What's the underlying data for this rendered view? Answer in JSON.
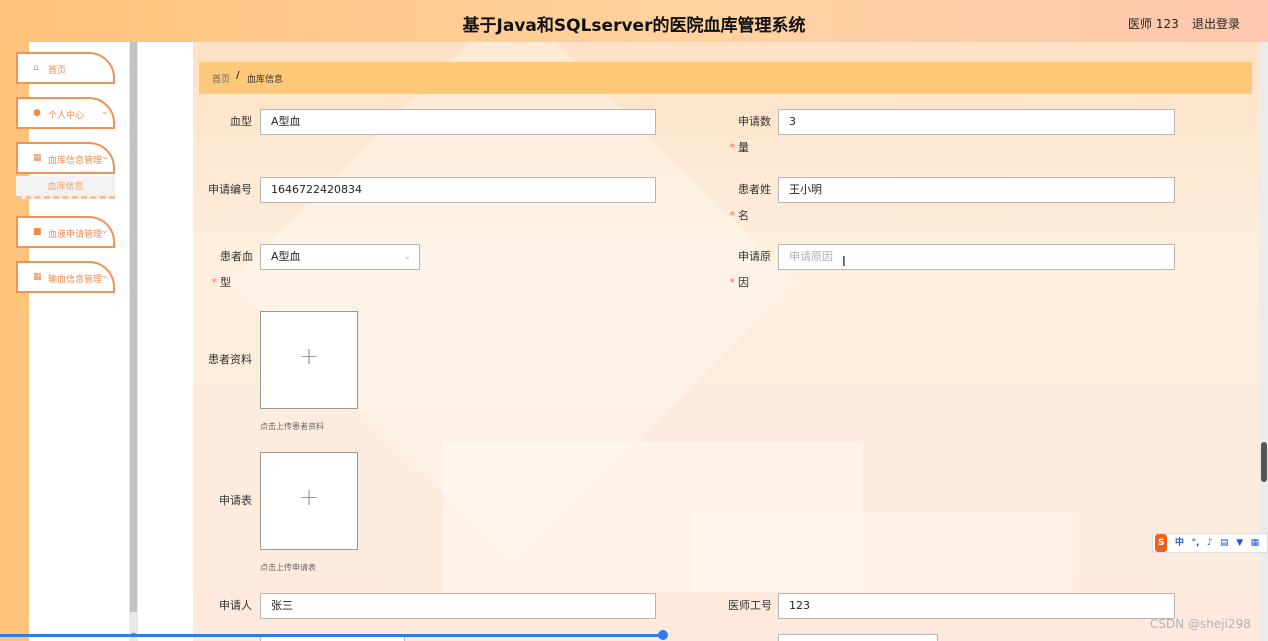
{
  "header": {
    "title": "基于Java和SQLserver的医院血库管理系统",
    "user": "医师 123",
    "logout": "退出登录"
  },
  "sidebar": {
    "items": [
      {
        "label": "首页",
        "icon": "home-icon"
      },
      {
        "label": "个人中心",
        "icon": "user-icon"
      },
      {
        "label": "血库信息管理",
        "icon": "grid-icon"
      },
      {
        "label": "血液申请管理",
        "icon": "blood-icon"
      },
      {
        "label": "输血信息管理",
        "icon": "grid-icon"
      }
    ],
    "submenu_label": "血库信息"
  },
  "breadcrumb": {
    "home": "首页",
    "separator": "/",
    "current": "血库信息"
  },
  "form": {
    "blood_type_label": "血型",
    "blood_type_value": "A型血",
    "request_qty_label": "申请数量",
    "request_qty_value": "3",
    "request_no_label": "申请编号",
    "request_no_value": "1646722420834",
    "patient_name_label": "患者姓名",
    "patient_name_value": "王小明",
    "patient_blood_label": "患者血型",
    "patient_blood_value": "A型血",
    "reason_label": "申请原因",
    "reason_placeholder": "申请原因",
    "patient_docs_label": "患者资料",
    "patient_docs_hint": "点击上传患者资料",
    "request_form_label": "申请表",
    "request_form_hint": "点击上传申请表",
    "applicant_label": "申请人",
    "applicant_value": "张三",
    "doctor_id_label": "医师工号",
    "doctor_id_value": "123"
  },
  "overlay": {
    "ime_logo": "S",
    "ime_lang": "中",
    "watermark": "CSDN @sheji298"
  },
  "colors": {
    "accent": "#ffc878",
    "menu_border": "#f0935a",
    "required": "#f56c6c"
  }
}
